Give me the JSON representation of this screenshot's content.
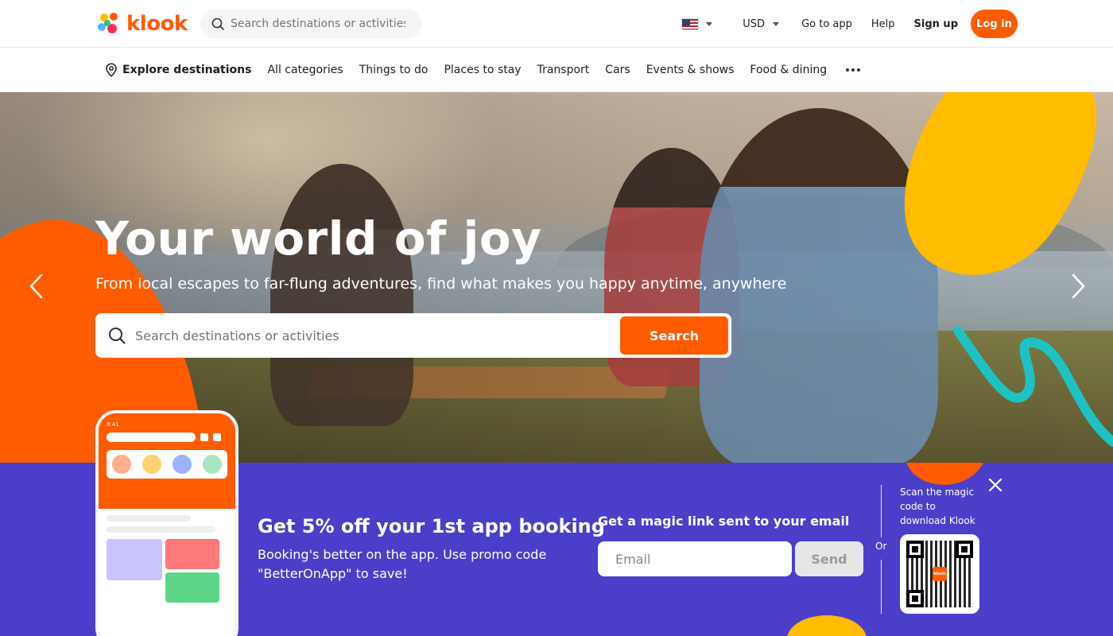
{
  "brand": {
    "name": "klook",
    "accent": "#ff5b00",
    "promo_bg": "#4b3ec9",
    "yellow": "#ffbc00"
  },
  "header": {
    "search_placeholder": "Search destinations or activities",
    "language_flag": "us-flag-icon",
    "currency": "USD",
    "go_to_app": "Go to app",
    "help": "Help",
    "sign_up": "Sign up",
    "log_in": "Log in"
  },
  "nav": {
    "explore": "Explore destinations",
    "items": [
      "All categories",
      "Things to do",
      "Places to stay",
      "Transport",
      "Cars",
      "Events & shows",
      "Food & dining"
    ]
  },
  "hero": {
    "title": "Your world of joy",
    "subtitle": "From local escapes to far-flung adventures, find what makes you happy anytime, anywhere",
    "search_placeholder": "Search destinations or activities",
    "search_button": "Search"
  },
  "promo": {
    "title": "Get 5% off your 1st app booking",
    "desc_line1": "Booking's better on the app. Use promo code",
    "desc_line2": "\"BetterOnApp\" to save!",
    "magic_title": "Get a magic link sent to your email",
    "email_placeholder": "Email",
    "send_button": "Send",
    "or": "Or",
    "qr_line1": "Scan the magic",
    "qr_line2": "code to",
    "qr_line3": "download Klook",
    "qr_logo": "klook",
    "phone_time": "9:41"
  }
}
